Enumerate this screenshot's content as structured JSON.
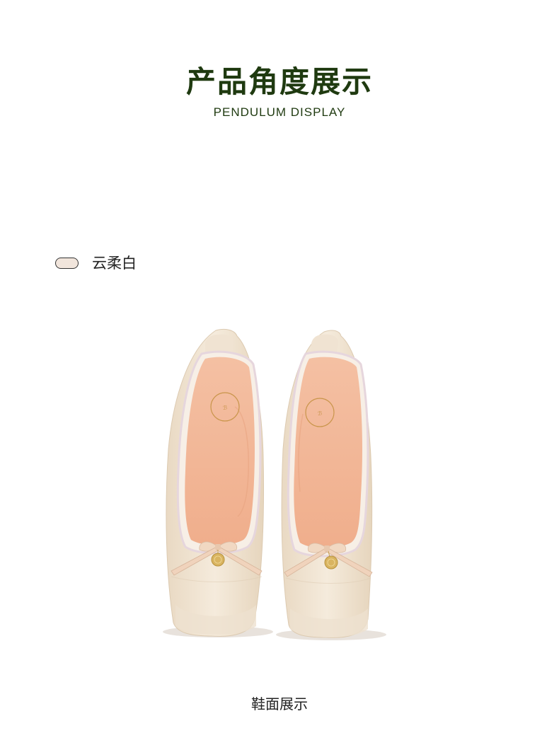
{
  "heading": {
    "title_cn": "产品角度展示",
    "title_en": "PENDULUM DISPLAY"
  },
  "colors": {
    "accent_text": "#1f3a10",
    "swatch_fill": "#f1e5dc",
    "shoe_body": "#efe2cf",
    "insole": "#f2b595"
  },
  "color_option": {
    "label": "云柔白",
    "swatch_color": "#f1e5dc"
  },
  "image": {
    "icon": "ballet-flats-pair",
    "caption": "鞋面展示"
  }
}
